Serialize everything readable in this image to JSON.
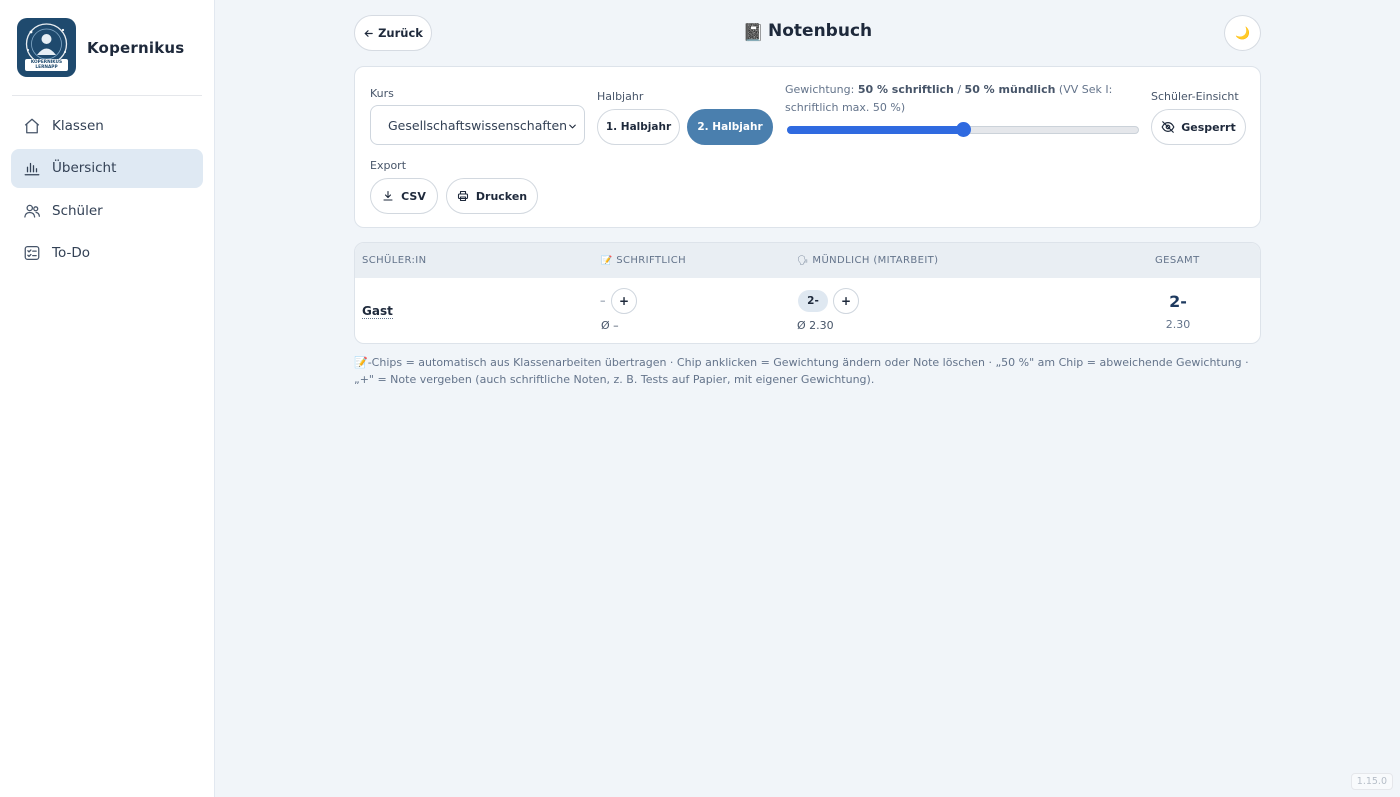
{
  "app": {
    "name": "Kopernikus",
    "logo_text": "KOPERNIKUS LERNAPP",
    "version": "1.15.0"
  },
  "sidebar": {
    "items": [
      {
        "label": "Klassen",
        "icon": "home-icon",
        "active": false
      },
      {
        "label": "Übersicht",
        "icon": "bar-chart-icon",
        "active": true
      },
      {
        "label": "Schüler",
        "icon": "users-icon",
        "active": false
      },
      {
        "label": "To-Do",
        "icon": "checklist-icon",
        "active": false
      }
    ]
  },
  "header": {
    "back_label": "Zurück",
    "title": "Notenbuch",
    "title_icon": "📓",
    "theme_icon": "🌙"
  },
  "controls": {
    "kurs_label": "Kurs",
    "kurs_value": "Gesellschaftswissenschaften",
    "halbjahr_label": "Halbjahr",
    "halbjahr_options": [
      "1. Halbjahr",
      "2. Halbjahr"
    ],
    "halbjahr_selected": 1,
    "weight_prefix": "Gewichtung: ",
    "weight_written": "50 % schriftlich",
    "weight_separator": " / ",
    "weight_oral": "50 % mündlich",
    "weight_note": " (VV Sek I: schriftlich max. 50 %)",
    "weight_percent": 50,
    "einsicht_label": "Schüler-Einsicht",
    "einsicht_value": "Gesperrt",
    "export_label": "Export",
    "csv_label": "CSV",
    "print_label": "Drucken"
  },
  "table": {
    "headers": {
      "student": "SCHÜLER:IN",
      "written": "SCHRIFTLICH",
      "oral": "MÜNDLICH (MITARBEIT)",
      "total": "GESAMT"
    },
    "header_icons": {
      "written": "📝",
      "oral": "🗣"
    },
    "rows": [
      {
        "name": "Gast",
        "written_dash": "–",
        "written_avg": "Ø –",
        "oral_grade": "2-",
        "oral_avg": "Ø 2.30",
        "total_grade": "2-",
        "total_avg": "2.30"
      }
    ],
    "add_label": "+"
  },
  "footnote": "📝-Chips = automatisch aus Klassenarbeiten übertragen · Chip anklicken = Gewichtung ändern oder Note löschen · „50 %\" am Chip = abweichende Gewichtung · „+\" = Note vergeben (auch schriftliche Noten, z. B. Tests auf Papier, mit eigener Gewichtung).",
  "colors": {
    "accent": "#4a7fae",
    "slider": "#2f6ae0",
    "brand_dark": "#1f4a6e"
  }
}
